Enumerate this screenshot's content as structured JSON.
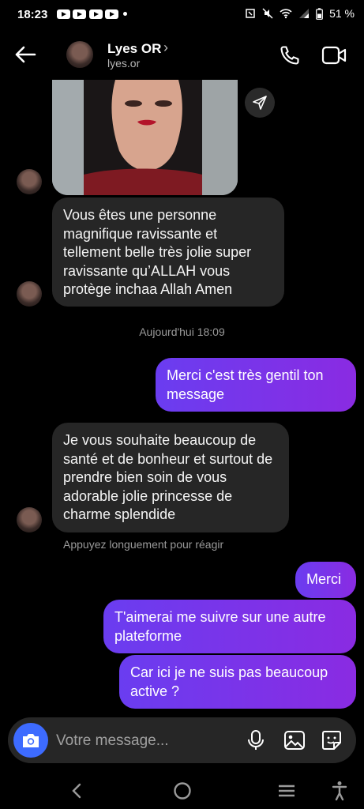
{
  "status": {
    "time": "18:23",
    "battery": "51 %"
  },
  "header": {
    "back_icon": "back-arrow-icon",
    "name": "Lyes OR",
    "chevron": "›",
    "handle": "lyes.or",
    "call_icon": "phone-icon",
    "video_icon": "video-camera-icon"
  },
  "messages": {
    "m1": "Vous êtes une personne magnifique ravissante et tellement belle très jolie super ravissante qu’ALLAH vous protège inchaa Allah Amen",
    "timestamp": "Aujourd'hui 18:09",
    "m2": "Merci c'est très gentil ton message",
    "m3": "Je vous souhaite beaucoup de santé et de bonheur et surtout de prendre bien soin de vous adorable jolie princesse de charme splendide",
    "hint": "Appuyez longuement pour réagir",
    "m4": "Merci",
    "m5": "T'aimerai me suivre sur une autre plateforme",
    "m6": "Car ici je ne suis pas beaucoup active ?"
  },
  "composer": {
    "placeholder": "Votre message..."
  }
}
